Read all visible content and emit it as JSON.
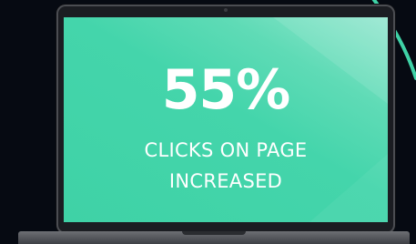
{
  "screen": {
    "stat": "55%",
    "caption_line1": "CLICKS ON PAGE",
    "caption_line2": "INCREASED"
  },
  "colors": {
    "background": "#060a12",
    "screen_green": "#3fd2a6",
    "accent_arc": "#3fd2a6",
    "text": "#ffffff"
  }
}
